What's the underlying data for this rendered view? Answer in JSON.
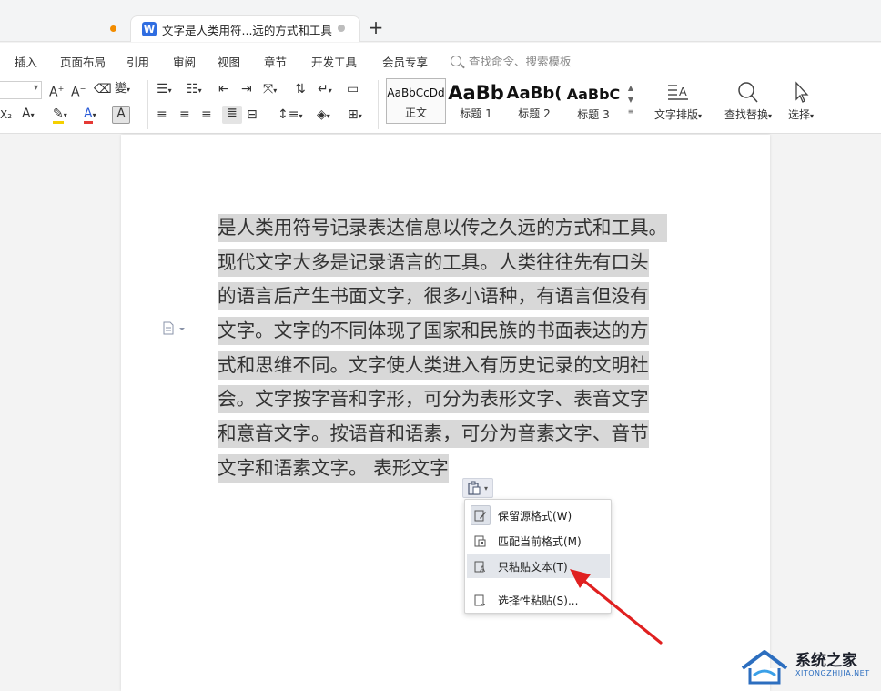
{
  "tabs": {
    "document_title": "文字是人类用符...远的方式和工具",
    "new_tab_label": "+"
  },
  "menu": {
    "items": [
      "插入",
      "页面布局",
      "引用",
      "审阅",
      "视图",
      "章节",
      "开发工具",
      "会员专享"
    ],
    "search_placeholder": "查找命令、搜索模板"
  },
  "ribbon": {
    "styles": [
      {
        "sample": "AaBbCcDd",
        "name": "正文"
      },
      {
        "sample": "AaBb",
        "name": "标题 1"
      },
      {
        "sample": "AaBb(",
        "name": "标题 2"
      },
      {
        "sample": "AaBbC",
        "name": "标题 3"
      }
    ],
    "text_layout_label": "文字排版",
    "find_replace_label": "查找替换",
    "select_label": "选择"
  },
  "document": {
    "lines": [
      "是人类用符号记录表达信息以传之久远的方式和工具。",
      "现代文字大多是记录语言的工具。人类往往先有口头",
      "的语言后产生书面文字，很多小语种，有语言但没有",
      "文字。文字的不同体现了国家和民族的书面表达的方",
      "式和思维不同。文字使人类进入有历史记录的文明社",
      "会。文字按字音和字形，可分为表形文字、表音文字",
      "和意音文字。按语音和语素，可分为音素文字、音节",
      "文字和语素文字。 表形文字"
    ]
  },
  "paste_menu": {
    "items": [
      {
        "label": "保留源格式(W)",
        "icon": "keep-format-icon"
      },
      {
        "label": "匹配当前格式(M)",
        "icon": "match-format-icon"
      },
      {
        "label": "只粘贴文本(T)",
        "icon": "text-only-icon"
      },
      {
        "label": "选择性粘贴(S)...",
        "icon": "paste-special-icon"
      }
    ],
    "hovered_index": 2
  },
  "watermark": {
    "title": "系统之家",
    "subtitle": "XITONGZHIJIA.NET"
  },
  "colors": {
    "accent_orange": "#f28c00",
    "wps_blue": "#2f6de1",
    "selection_gray": "#d8d8d8",
    "arrow_red": "#e02020",
    "highlight_yellow": "#f5d000",
    "font_color_red": "#e53935"
  }
}
